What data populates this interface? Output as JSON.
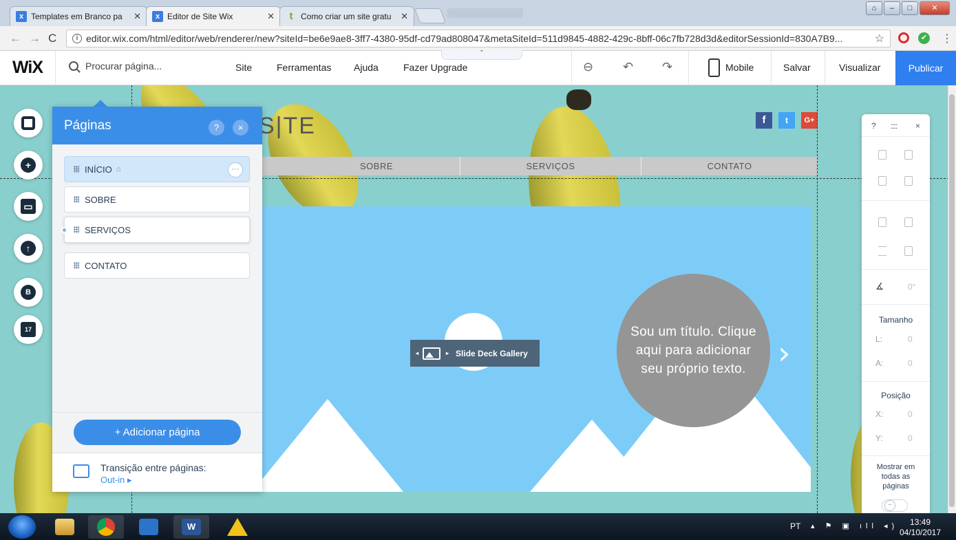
{
  "browser": {
    "tabs": [
      {
        "title": "Templates em Branco pa",
        "icon": "wix-favicon"
      },
      {
        "title": "Editor de Site Wix",
        "icon": "wix-favicon"
      },
      {
        "title": "Como criar um site gratu",
        "icon": "tt-favicon"
      }
    ],
    "url": "editor.wix.com/html/editor/web/renderer/new?siteId=be6e9ae8-3ff7-4380-95df-cd79ad808047&metaSiteId=511d9845-4882-429c-8bff-06c7fb728d3d&editorSessionId=830A7B9..."
  },
  "wix": {
    "logo": "WiX",
    "search_placeholder": "Procurar página...",
    "menu": [
      "Site",
      "Ferramentas",
      "Ajuda",
      "Fazer Upgrade"
    ],
    "mobile_label": "Mobile",
    "save_label": "Salvar",
    "preview_label": "Visualizar",
    "publish_label": "Publicar",
    "colors": {
      "accent": "#3b8ee8",
      "publish": "#2f7ff0",
      "canvas_bg": "#89cfcd",
      "slide_bg": "#7dccf8"
    }
  },
  "site": {
    "title_fragment": "S|TE",
    "nav": [
      "SOBRE",
      "SERVIÇOS",
      "CONTATO"
    ],
    "social": [
      "f",
      "t",
      "G+"
    ],
    "headline": "Sou um título. Clique aqui para adicionar seu próprio texto.",
    "gallery_badge": "Slide Deck Gallery"
  },
  "pages_panel": {
    "title": "Páginas",
    "help": "?",
    "close": "×",
    "pages": [
      {
        "label": "INÍCIO",
        "selected": true,
        "home": true
      },
      {
        "label": "SOBRE",
        "selected": false
      },
      {
        "label": "SERVIÇOS",
        "selected": false,
        "subpage_marker": true
      },
      {
        "label": "CONTATO",
        "selected": false
      }
    ],
    "more": "···",
    "add_page": "+ Adicionar página",
    "transition_title": "Transição entre páginas:",
    "transition_value": "Out-in ▸"
  },
  "inspector": {
    "help": "?",
    "grip": "::::",
    "close": "×",
    "rotation": "0°",
    "size_label": "Tamanho",
    "w_key": "L:",
    "w_val": "0",
    "h_key": "A:",
    "h_val": "0",
    "pos_label": "Posição",
    "x_key": "X:",
    "x_val": "0",
    "y_key": "Y:",
    "y_val": "0",
    "show_all_label": "Mostrar em todas as páginas",
    "show_all_on": false
  },
  "taskbar": {
    "language": "PT",
    "time": "13:49",
    "date": "04/10/2017"
  }
}
